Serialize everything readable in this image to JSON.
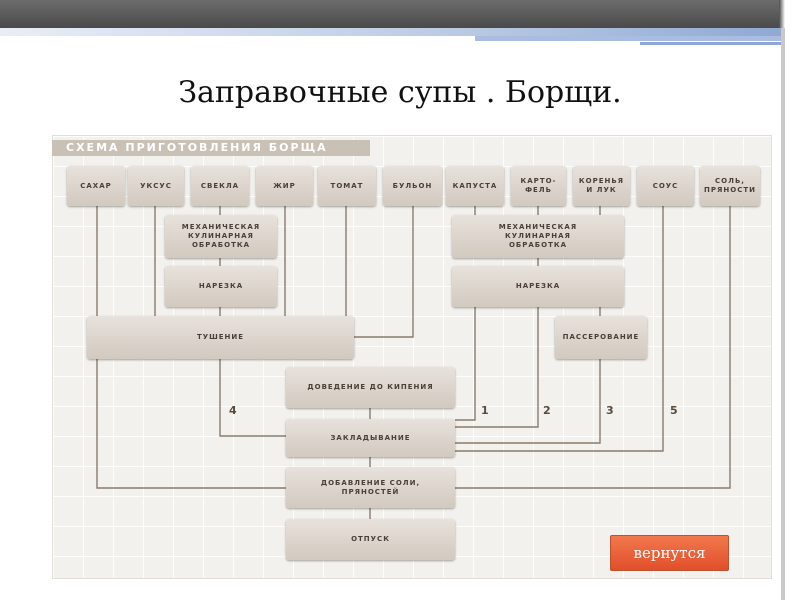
{
  "slide": {
    "title": "Заправочные супы . Борщи."
  },
  "diagram": {
    "header": "СХЕМА ПРИГОТОВЛЕНИЯ БОРЩА",
    "ingredients": {
      "sugar": "САХАР",
      "vinegar": "УКСУС",
      "beet": "СВЕКЛА",
      "fat": "ЖИР",
      "tomato": "ТОМАТ",
      "broth": "БУЛЬОН",
      "cabbage": "КАПУСТА",
      "potato": "КАРТО-\nФЕЛЬ",
      "roots": "КОРЕНЬЯ\nИ ЛУК",
      "sauce": "СОУС",
      "salt": "СОЛЬ,\nПРЯНОСТИ"
    },
    "steps": {
      "mech_left": "МЕХАНИЧЕСКАЯ\nКУЛИНАРНАЯ\nОБРАБОТКА",
      "cut_left": "НАРЕЗКА",
      "stew": "ТУШЕНИЕ",
      "mech_right": "МЕХАНИЧЕСКАЯ\nКУЛИНАРНАЯ\nОБРАБОТКА",
      "cut_right": "НАРЕЗКА",
      "saute": "ПАССЕРОВАНИЕ",
      "boil": "ДОВЕДЕНИЕ ДО КИПЕНИЯ",
      "lay": "ЗАКЛАДЫВАНИЕ",
      "add_salt": "ДОБАВЛЕНИЕ СОЛИ,\nПРЯНОСТЕЙ",
      "serve": "ОТПУСК"
    },
    "numbers": {
      "n1": "1",
      "n2": "2",
      "n3": "3",
      "n4": "4",
      "n5": "5"
    }
  },
  "nav": {
    "back_label": "вернутся",
    "button_color": "#e65a32"
  },
  "colors": {
    "connector": "#8a7b6d",
    "box_text": "#4a3f36"
  }
}
